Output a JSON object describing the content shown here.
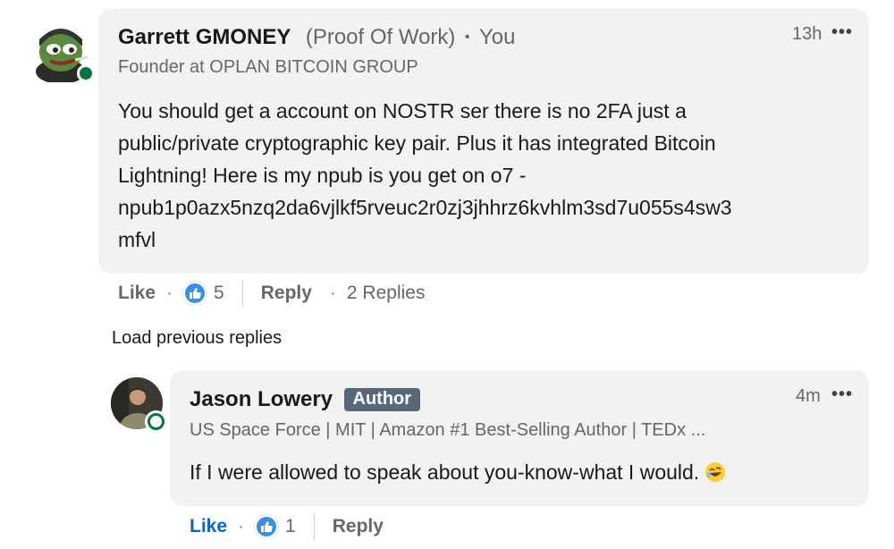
{
  "comment": {
    "author": "Garrett GMONEY",
    "pronoun_tag": "(Proof Of Work)",
    "separator": "•",
    "you_label": "You",
    "headline": "Founder at OPLAN BITCOIN GROUP",
    "time": "13h",
    "more": "•••",
    "body": "You should get a account on NOSTR ser there is no 2FA just a public/private cryptographic key pair. Plus it has integrated Bitcoin Lightning! Here is my npub is you get on o7 - npub1p0azx5nzq2da6vjlkf5rveuc2r0zj3jhhrz6kvhlm3sd7u055s4sw3 mfvl",
    "body_lines": [
      "You should get a account on NOSTR ser there is no 2FA just a",
      "public/private cryptographic key pair. Plus it has integrated Bitcoin",
      "Lightning! Here is my npub is you get on o7 -",
      "npub1p0azx5nzq2da6vjlkf5rveuc2r0zj3jhhrz6kvhlm3sd7u055s4sw3",
      "mfvl"
    ],
    "actions": {
      "like": "Like",
      "dot": "·",
      "reaction_count": "5",
      "reply": "Reply",
      "replies": "2 Replies"
    }
  },
  "load_previous": "Load previous replies",
  "reply": {
    "author": "Jason Lowery",
    "badge": "Author",
    "headline": "US Space Force | MIT | Amazon #1 Best-Selling Author | TEDx ...",
    "time": "4m",
    "more": "•••",
    "body": "If I were allowed to speak about you-know-what I would.",
    "emoji": "rolling-on-floor-laughing",
    "actions": {
      "like": "Like",
      "dot": "·",
      "reaction_count": "1",
      "reply": "Reply"
    }
  },
  "colors": {
    "bubble": "#f2f2f2",
    "presence": "#057642",
    "link_blue": "#0a66c2",
    "like_icon": "#378fe9",
    "badge": "#56687a"
  }
}
